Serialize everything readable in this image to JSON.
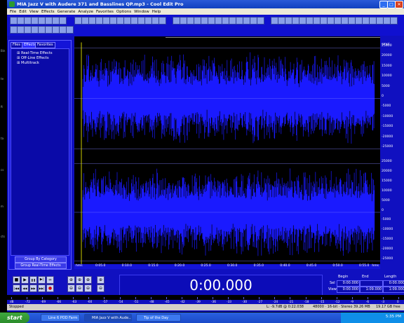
{
  "window": {
    "title": "MIA Jazz V with Audere 371 and Basslines QP.mp3 - Cool Edit Pro",
    "btn_min": "_",
    "btn_max": "□",
    "btn_close": "✕"
  },
  "menu": [
    "File",
    "Edit",
    "View",
    "Effects",
    "Generate",
    "Analyze",
    "Favorites",
    "Options",
    "Window",
    "Help"
  ],
  "panel": {
    "tabs": [
      "Files",
      "Effects",
      "Favorites"
    ],
    "tree": [
      "Real-Time Effects",
      "Off-Line Effects",
      "Multitrack"
    ],
    "btn_category": "Group By Category",
    "btn_realtime": "Group Real-Time Effects"
  },
  "scale": {
    "top_label": "smpl",
    "ch1": [
      "25000",
      "20000",
      "15000",
      "10000",
      "5000",
      "0",
      "-5000",
      "-10000",
      "-15000",
      "-20000",
      "-25000"
    ],
    "ch2": [
      "25000",
      "20000",
      "15000",
      "10000",
      "5000",
      "0",
      "-5000",
      "-10000",
      "-15000",
      "-20000",
      "-25000"
    ]
  },
  "timeline": {
    "start": "hms",
    "ticks": [
      "0:05.0",
      "0:10.0",
      "0:15.0",
      "0:20.0",
      "0:25.0",
      "0:30.0",
      "0:35.0",
      "0:40.0",
      "0:45.0",
      "0:50.0",
      "0:55.0"
    ],
    "end": "hms"
  },
  "transport": {
    "stop": "■",
    "play": "▶",
    "pause": "❚❚",
    "play_to_end": "▶|",
    "loop": "∞",
    "goto_start": "|◀◀",
    "rewind": "◀◀",
    "ffwd": "▶▶",
    "goto_end": "▶▶|",
    "record": "●"
  },
  "zoom": [
    "⊕",
    "⊕",
    "⊕",
    "⊕",
    "⊖",
    "⊖",
    "⊖",
    "⊖"
  ],
  "time_display": "0:00.000",
  "selection": {
    "col_begin": "Begin",
    "col_end": "End",
    "col_length": "Length",
    "row_sel": "Sel",
    "row_view": "View",
    "sel_begin": "0:00.000",
    "sel_end": "",
    "sel_length": "0:00.000",
    "view_begin": "0:00.000",
    "view_end": "1:09.000",
    "view_length": "1:09.000"
  },
  "level_meter": [
    "dB",
    "-72",
    "-69",
    "-66",
    "-63",
    "-60",
    "-57",
    "-54",
    "-51",
    "-48",
    "-45",
    "-42",
    "-39",
    "-36",
    "-33",
    "-30",
    "-27",
    "-24",
    "-21",
    "-18",
    "-15",
    "-12",
    "-9",
    "-6",
    "-3",
    "0"
  ],
  "status": {
    "state": "Stopped",
    "level": "L: -9.7dB @ 0:22.038",
    "format": "48000 · 16-bit · Stereo",
    "size": "39.26 MB",
    "free": "19.17 GB free"
  },
  "taskbar": {
    "start": "start",
    "tasks": [
      "Line 6 POD Farm",
      "MIA Jazz V with Aude...",
      "Tip of the Day"
    ],
    "clock": "5:35 PM"
  },
  "desktop_labels": [
    "Bin",
    "te",
    "ft",
    "ta",
    "cs",
    "m",
    "cts"
  ]
}
